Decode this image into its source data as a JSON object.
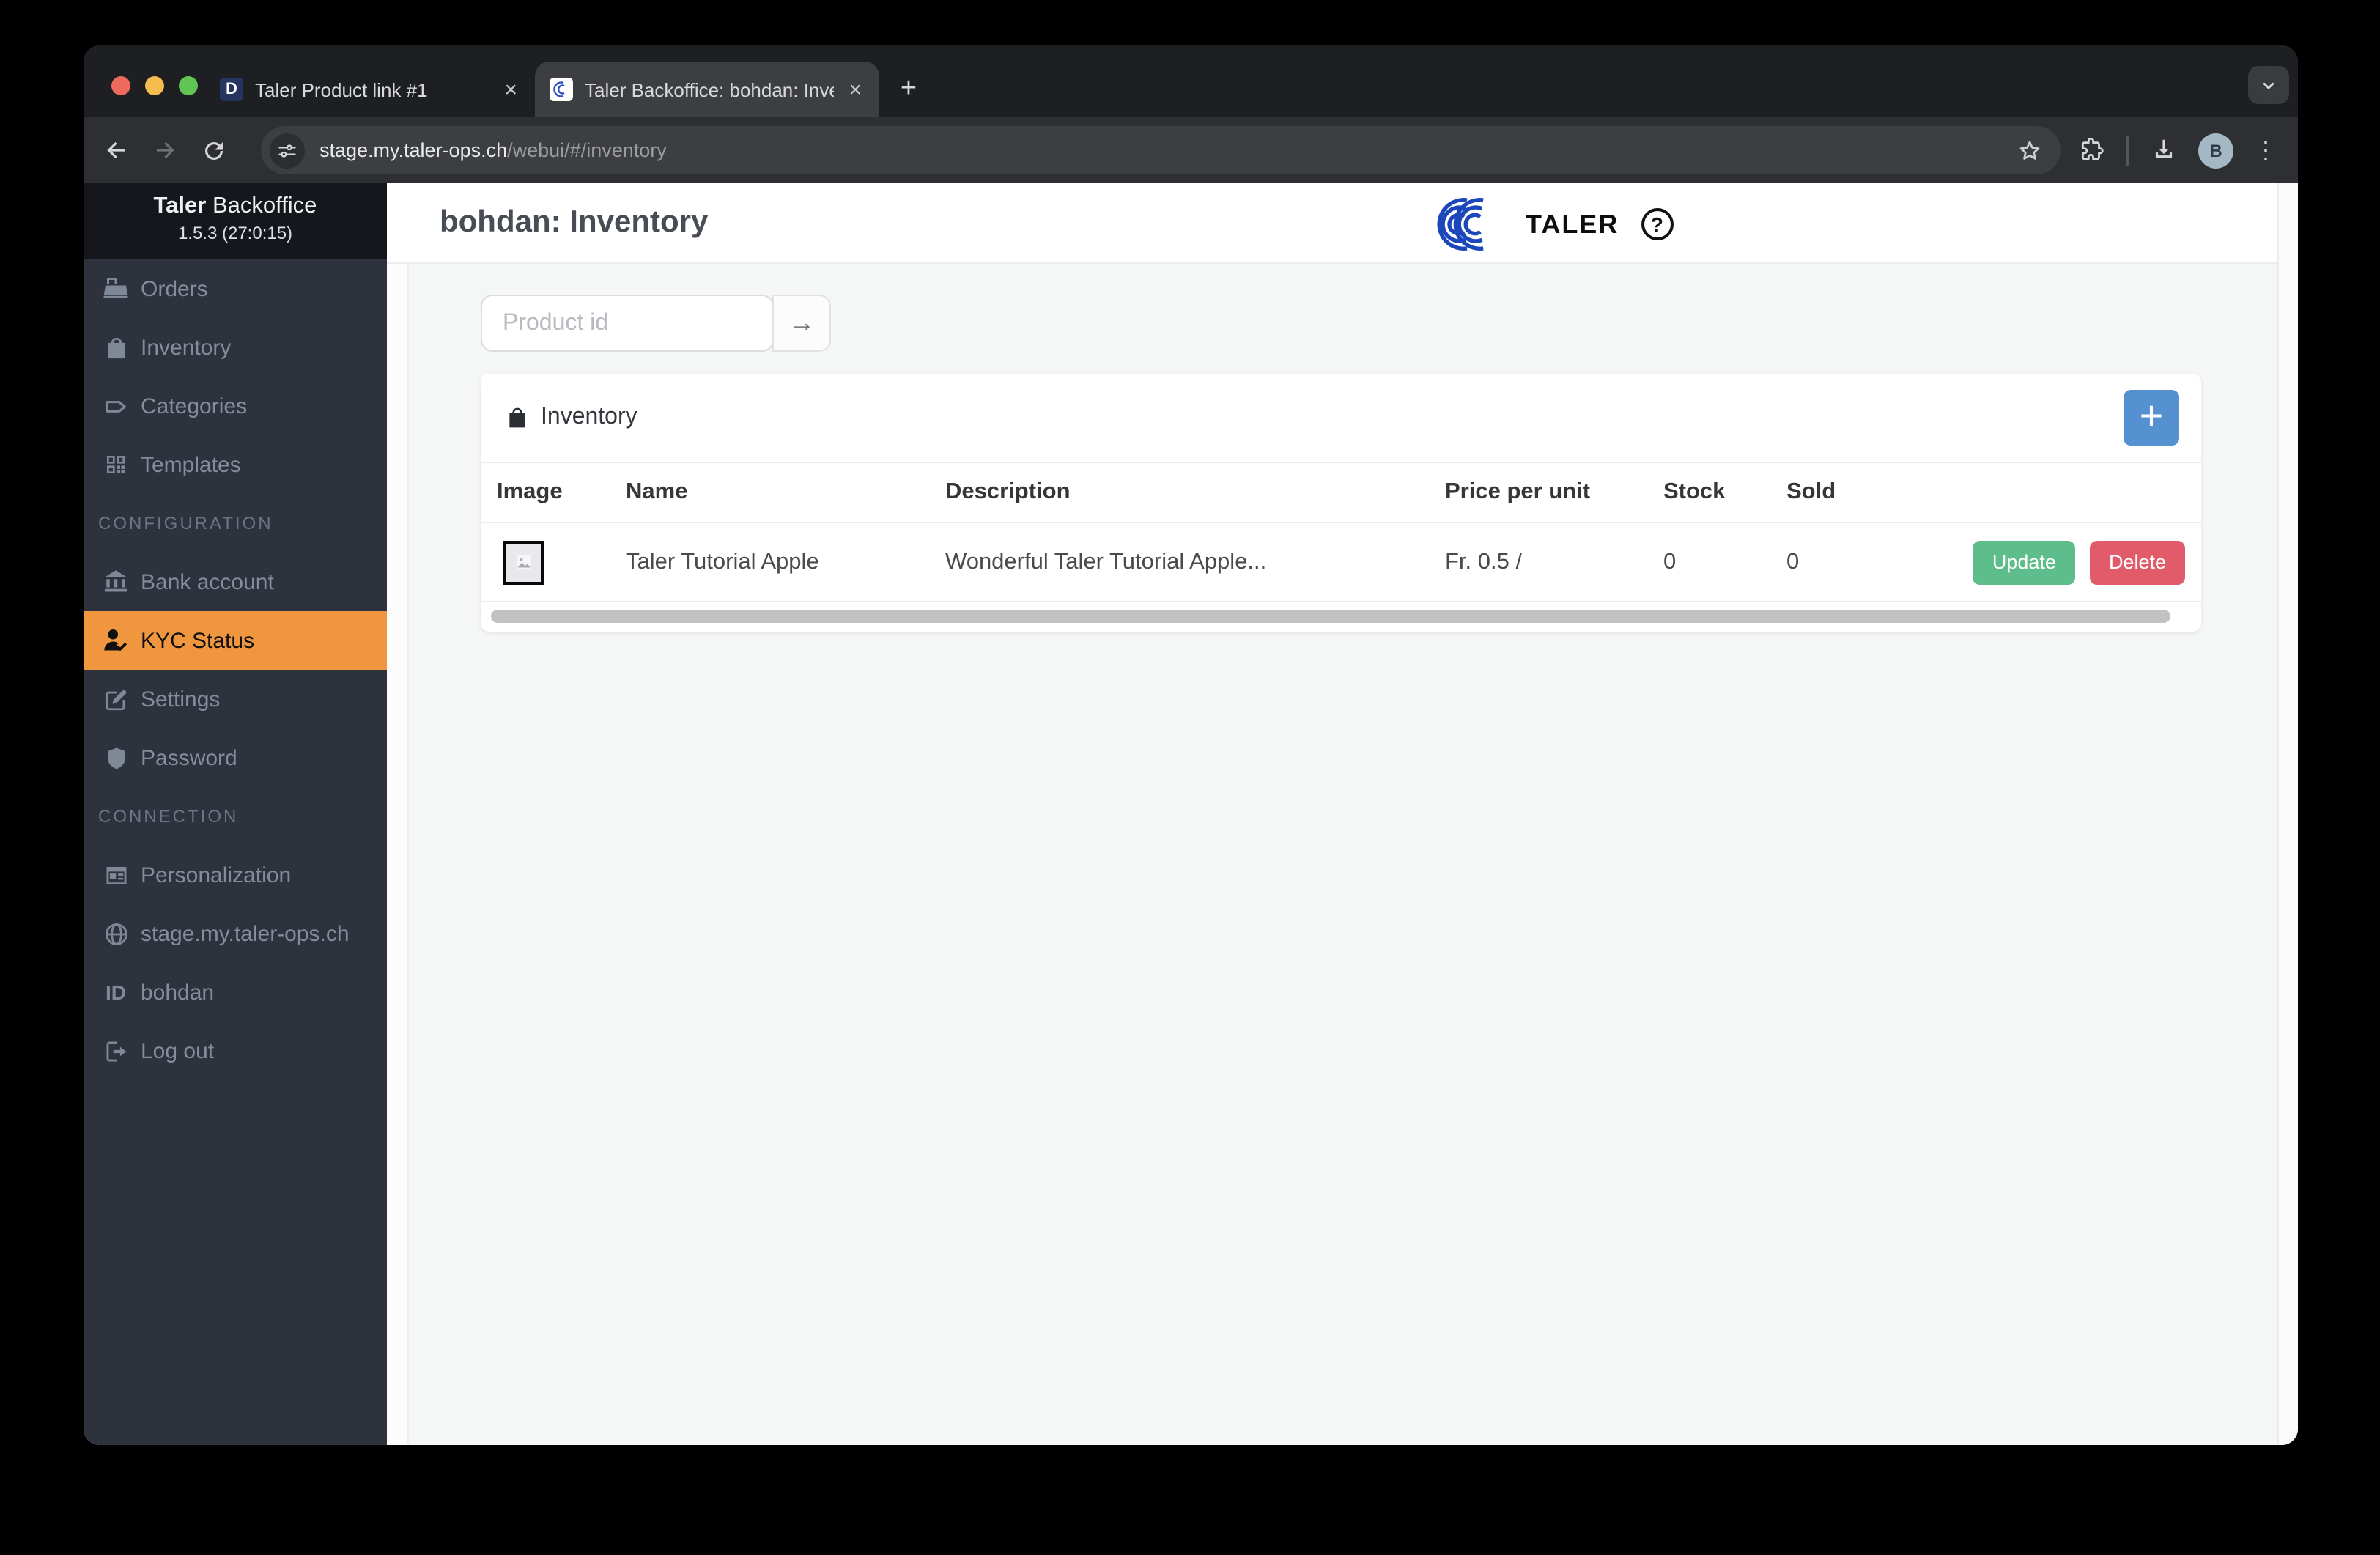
{
  "browser": {
    "tabs": [
      {
        "title": "Taler Product link #1",
        "favicon_letter": "D",
        "active": false
      },
      {
        "title": "Taler Backoffice: bohdan: Inve",
        "favicon": "taler-spiral",
        "active": true
      }
    ],
    "address": {
      "host": "stage.my.taler-ops.ch",
      "path": "/webui/#/inventory"
    },
    "profile_initial": "B"
  },
  "glyphs": {
    "tab_close": "×",
    "new_tab": "+",
    "menu_dots": "⋮",
    "submit_arrow": "→",
    "help": "?",
    "id_badge": "ID",
    "plus": "+"
  },
  "sidebar": {
    "brand_bold": "Taler",
    "brand_regular": "Backoffice",
    "version": "1.5.3 (27:0:15)",
    "sections": [
      {
        "items": [
          {
            "label": "Orders",
            "icon": "cash-register"
          },
          {
            "label": "Inventory",
            "icon": "shopping-bag"
          },
          {
            "label": "Categories",
            "icon": "tag"
          },
          {
            "label": "Templates",
            "icon": "qr-code"
          }
        ]
      },
      {
        "label": "CONFIGURATION",
        "items": [
          {
            "label": "Bank account",
            "icon": "bank"
          },
          {
            "label": "KYC Status",
            "icon": "user-check",
            "active": true
          },
          {
            "label": "Settings",
            "icon": "edit-square"
          },
          {
            "label": "Password",
            "icon": "shield"
          }
        ]
      },
      {
        "label": "CONNECTION",
        "items": [
          {
            "label": "Personalization",
            "icon": "newspaper"
          },
          {
            "label": "stage.my.taler-ops.ch",
            "icon": "globe"
          },
          {
            "label": "bohdan",
            "icon": "id-badge"
          },
          {
            "label": "Log out",
            "icon": "logout"
          }
        ]
      }
    ]
  },
  "header": {
    "title": "bohdan: Inventory",
    "logo_text": "TALER"
  },
  "search": {
    "placeholder": "Product id"
  },
  "inventory": {
    "card_title": "Inventory",
    "columns": [
      "Image",
      "Name",
      "Description",
      "Price per unit",
      "Stock",
      "Sold"
    ],
    "rows": [
      {
        "name": "Taler Tutorial Apple",
        "description": "Wonderful Taler Tutorial Apple...",
        "price_per_unit": "Fr. 0.5 /",
        "stock": "0",
        "sold": "0",
        "update_label": "Update",
        "delete_label": "Delete"
      }
    ]
  },
  "colors": {
    "accent_orange": "#f0963f",
    "success_green": "#5dbd8b",
    "danger_red": "#e25b6b",
    "info_blue": "#5590d0",
    "taler_blue": "#1c47bb",
    "sidebar_bg": "#2e323c",
    "content_bg": "#f5f6f6"
  }
}
